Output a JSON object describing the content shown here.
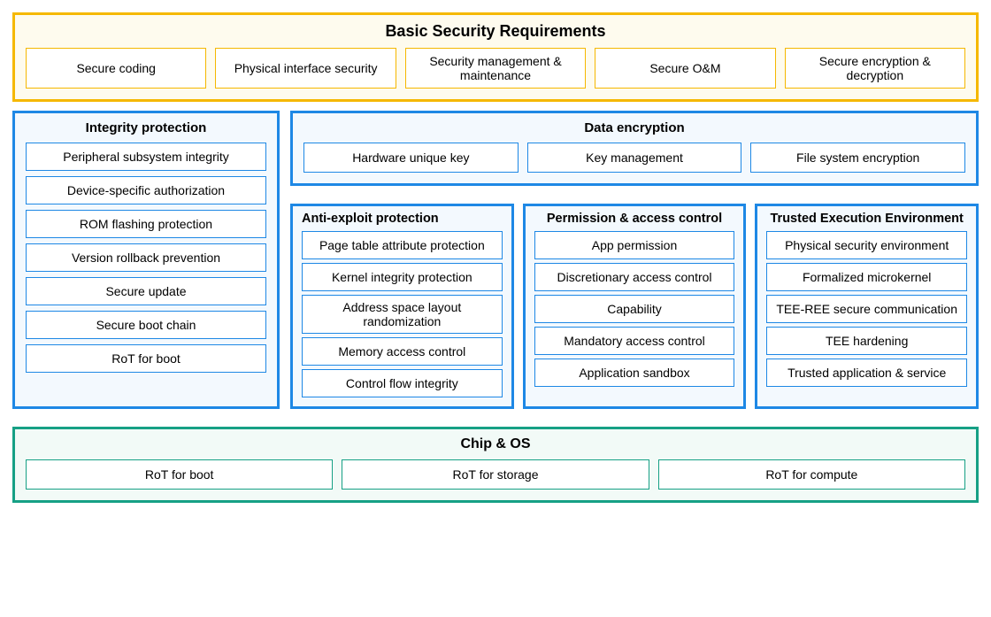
{
  "basic": {
    "title": "Basic Security Requirements",
    "items": [
      "Secure coding",
      "Physical interface security",
      "Security management & maintenance",
      "Secure O&M",
      "Secure encryption & decryption"
    ]
  },
  "integrity": {
    "title": "Integrity protection",
    "items": [
      "Peripheral subsystem integrity",
      "Device-specific authorization",
      "ROM flashing protection",
      "Version rollback prevention",
      "Secure update",
      "Secure boot chain",
      "RoT for boot"
    ]
  },
  "dataEncryption": {
    "title": "Data encryption",
    "items": [
      "Hardware unique key",
      "Key management",
      "File system encryption"
    ]
  },
  "antiExploit": {
    "title": "Anti-exploit protection",
    "items": [
      "Page table attribute protection",
      "Kernel integrity protection",
      "Address space layout randomization",
      "Memory access control",
      "Control flow integrity"
    ]
  },
  "permission": {
    "title": "Permission & access control",
    "items": [
      "App permission",
      "Discretionary access control",
      "Capability",
      "Mandatory access control",
      "Application sandbox"
    ]
  },
  "tee": {
    "title": "Trusted Execution Environment",
    "items": [
      "Physical security environment",
      "Formalized microkernel",
      "TEE-REE secure communication",
      "TEE hardening",
      "Trusted application & service"
    ]
  },
  "chipos": {
    "title": "Chip & OS",
    "items": [
      "RoT for boot",
      "RoT for storage",
      "RoT for compute"
    ]
  }
}
